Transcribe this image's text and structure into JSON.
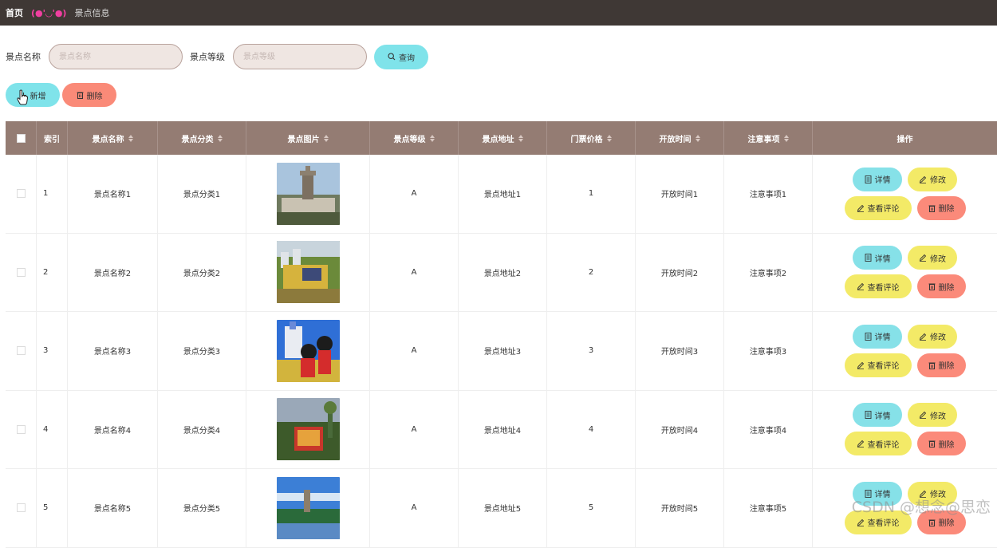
{
  "breadcrumb": {
    "home": "首页",
    "separator": "(●'◡'●)",
    "current": "景点信息"
  },
  "search": {
    "name_label": "景点名称",
    "name_placeholder": "景点名称",
    "level_label": "景点等级",
    "level_placeholder": "景点等级",
    "search_button": "查询"
  },
  "toolbar": {
    "add_button": "新增",
    "delete_button": "删除"
  },
  "table": {
    "headers": [
      "索引",
      "景点名称",
      "景点分类",
      "景点图片",
      "景点等级",
      "景点地址",
      "门票价格",
      "开放时间",
      "注意事项",
      "操作"
    ],
    "rows": [
      {
        "index": "1",
        "name": "景点名称1",
        "category": "景点分类1",
        "level": "A",
        "address": "景点地址1",
        "price": "1",
        "open_time": "开放时间1",
        "notes": "注意事项1"
      },
      {
        "index": "2",
        "name": "景点名称2",
        "category": "景点分类2",
        "level": "A",
        "address": "景点地址2",
        "price": "2",
        "open_time": "开放时间2",
        "notes": "注意事项2"
      },
      {
        "index": "3",
        "name": "景点名称3",
        "category": "景点分类3",
        "level": "A",
        "address": "景点地址3",
        "price": "3",
        "open_time": "开放时间3",
        "notes": "注意事项3"
      },
      {
        "index": "4",
        "name": "景点名称4",
        "category": "景点分类4",
        "level": "A",
        "address": "景点地址4",
        "price": "4",
        "open_time": "开放时间4",
        "notes": "注意事项4"
      },
      {
        "index": "5",
        "name": "景点名称5",
        "category": "景点分类5",
        "level": "A",
        "address": "景点地址5",
        "price": "5",
        "open_time": "开放时间5",
        "notes": "注意事项5"
      }
    ],
    "row_actions": {
      "detail": "详情",
      "edit": "修改",
      "review": "查看评论",
      "delete": "删除"
    }
  },
  "watermark": "CSDN @想念@思恋",
  "colors": {
    "header_bg": "#3f3835",
    "table_head": "#947c73",
    "cyan": "#7fe3ea",
    "yellow": "#f3ea67",
    "salmon": "#fa8a78"
  }
}
